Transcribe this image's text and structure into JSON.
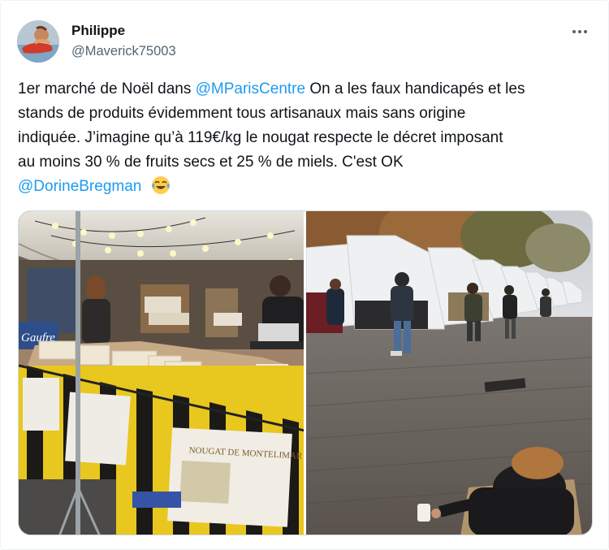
{
  "tweet": {
    "author_name": "Philippe",
    "author_handle": "@Maverick75003",
    "text": {
      "l1_a": "1er marché de Noël dans ",
      "l1_mention": "@MParisCentre",
      "l1_b": " On a les faux handicapés et les",
      "l2": "stands de produits évidemment tous artisanaux mais sans origine",
      "l3": "indiquée. J’imagine qu’à 119€/kg le nougat respecte le décret imposant",
      "l4": "au moins 30 % de fruits secs et 25 % de miels. C'est OK",
      "l5_mention": "@DorineBregman",
      "emoji": "face-with-tears-of-joy"
    },
    "media": {
      "photo1": {
        "sign_gaufre": "Gaufre",
        "banner_label_1": "NOUGAT DE MONTELIMAR",
        "banner_label_2": "NOUGAT DE MONTELIMAR"
      }
    }
  },
  "colors": {
    "link": "#1d9bf0",
    "text": "#0f1419",
    "secondary": "#536471"
  },
  "icons": [
    "more-icon",
    "emoji-icon"
  ]
}
